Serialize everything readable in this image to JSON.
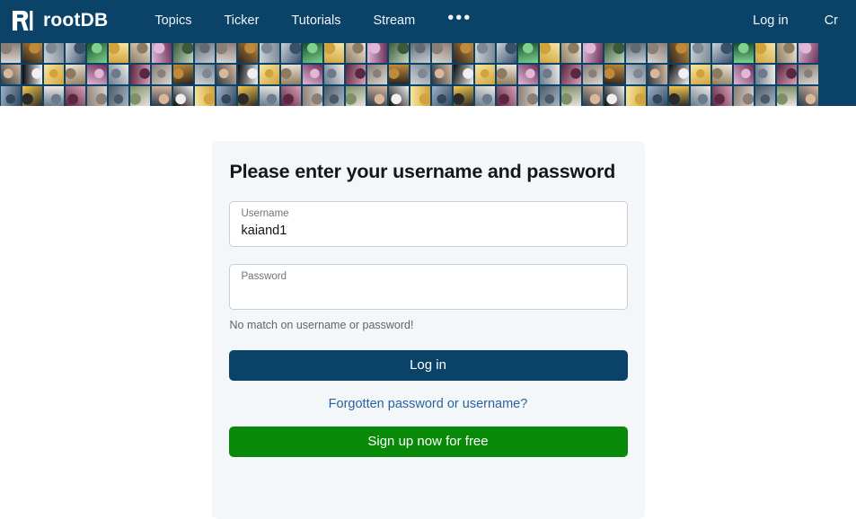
{
  "navbar": {
    "logo_icon": "rootdb-r-logo-icon",
    "brand": "rootDB",
    "links": [
      {
        "label": "Topics"
      },
      {
        "label": "Ticker"
      },
      {
        "label": "Tutorials"
      },
      {
        "label": "Stream"
      }
    ],
    "more_icon": "•••",
    "right_links": [
      {
        "label": "Log in"
      },
      {
        "label": "Cr"
      }
    ],
    "background": "#0a4268"
  },
  "banner": {
    "name": "avatar-mosaic-banner",
    "columns": 38,
    "rows": 3,
    "background": "#0a4268"
  },
  "login_card": {
    "title": "Please enter your username and password",
    "username": {
      "label": "Username",
      "value": "kaiand1",
      "placeholder": ""
    },
    "password": {
      "label": "Password",
      "value": "",
      "placeholder": ""
    },
    "message": "No match on username or password!",
    "login_button": "Log in",
    "forgot_link": "Forgotten password or username?",
    "signup_button": "Sign up now for free",
    "colors": {
      "card_bg": "#f3f7f9",
      "login_btn": "#0a4268",
      "signup_btn": "#088a08",
      "link": "#2a62a0",
      "message": "#5d656d"
    }
  }
}
